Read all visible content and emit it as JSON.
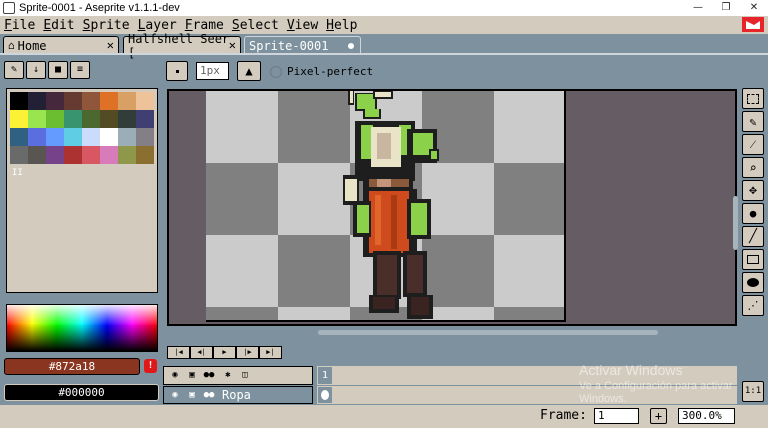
{
  "window": {
    "title": "Sprite-0001 - Aseprite v1.1.1-dev",
    "minimize": "—",
    "maximize": "❐",
    "close": "✕"
  },
  "menu": [
    {
      "label": "File",
      "u": "F",
      "rest": "ile"
    },
    {
      "label": "Edit",
      "u": "E",
      "rest": "dit"
    },
    {
      "label": "Sprite",
      "u": "S",
      "rest": "prite"
    },
    {
      "label": "Layer",
      "u": "L",
      "rest": "ayer"
    },
    {
      "label": "Frame",
      "u": "F",
      "rest": "rame"
    },
    {
      "label": "Select",
      "u": "S",
      "rest": "elect"
    },
    {
      "label": "View",
      "u": "V",
      "rest": "iew"
    },
    {
      "label": "Help",
      "u": "H",
      "rest": "elp"
    }
  ],
  "tabs": [
    {
      "label": "Home",
      "icon": "home-icon",
      "close": "✕"
    },
    {
      "label": "Halfshell Seer [",
      "close": "✕"
    },
    {
      "label": "Sprite-0001",
      "modified": true
    }
  ],
  "context_bar": {
    "brush_size": "1px",
    "pixel_perfect_label": "Pixel-perfect"
  },
  "palette": {
    "drag_handle": "II",
    "colors": [
      "#000000",
      "#222034",
      "#45283c",
      "#663931",
      "#8f563b",
      "#df7126",
      "#d9a066",
      "#eec39a",
      "#fbf236",
      "#99e550",
      "#6abe30",
      "#37946e",
      "#4b692f",
      "#524b24",
      "#323c39",
      "#3f3f74",
      "#306082",
      "#5b6ee1",
      "#639bff",
      "#5fcde4",
      "#cbdbfc",
      "#ffffff",
      "#9badb7",
      "#847e87",
      "#696a6a",
      "#595652",
      "#76428a",
      "#ac3232",
      "#d95763",
      "#d77bba",
      "#8f974a",
      "#8a6f30"
    ]
  },
  "colors": {
    "foreground": "#872a18",
    "background": "#000000",
    "warning_icon": "!"
  },
  "timeline": {
    "frame_number": "1",
    "layer_name": "Ropa"
  },
  "watermark": {
    "title": "Activar Windows",
    "subtitle": "Ve a Configuración para activar Windows."
  },
  "status": {
    "frame_label": "Frame:",
    "frame_value": "1",
    "add_frame": "+",
    "zoom": "300.0%"
  },
  "scale_button": "1:1"
}
